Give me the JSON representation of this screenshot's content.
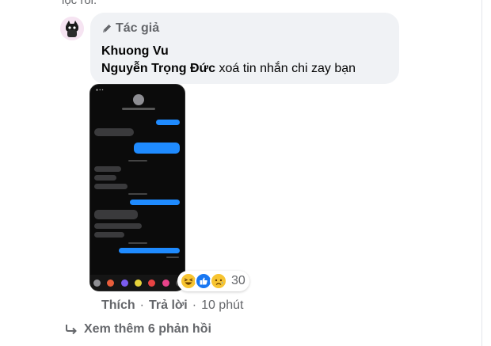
{
  "top_text": "lọc rồi.",
  "comment": {
    "author_label": "Tác giả",
    "author_name": "Khuong Vu",
    "mention": "Nguyễn Trọng Đức",
    "text": "xoá tin nhắn chi zay bạn"
  },
  "reactions": {
    "icons": [
      "haha-icon",
      "like-icon",
      "sad-icon"
    ],
    "count": "30"
  },
  "actions": {
    "like": "Thích",
    "reply": "Trả lời",
    "separator": "·",
    "time": "10 phút"
  },
  "more_replies": "Xem thêm 6 phản hồi",
  "colors": {
    "bubble": "#f0f2f5",
    "muted": "#65676b",
    "ios_blue": "#1f8bff"
  }
}
